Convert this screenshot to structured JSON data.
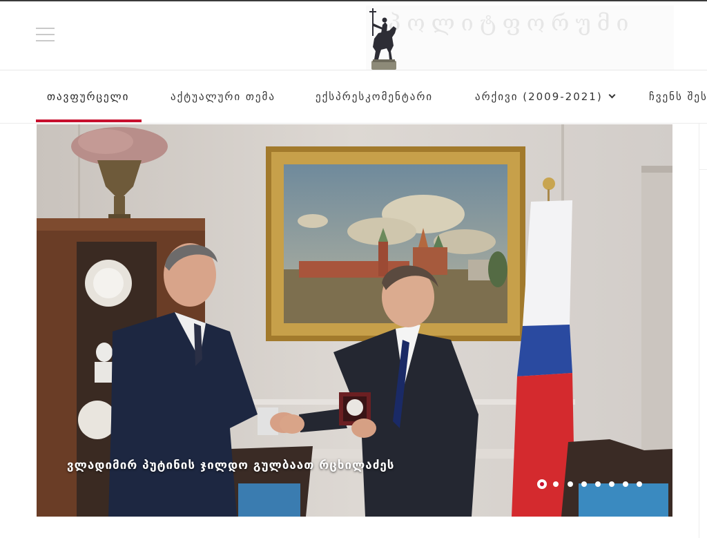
{
  "header": {
    "logo_text": "პოლიტფორუმი",
    "menu_icon": "hamburger-menu-icon"
  },
  "nav": {
    "items": [
      {
        "label": "თავფურცელი",
        "active": true
      },
      {
        "label": "აქტუალური თემა",
        "active": false
      },
      {
        "label": "ექსპრესკომენტარი",
        "active": false
      },
      {
        "label": "არქივი (2009-2021)",
        "active": false,
        "has_dropdown": true
      },
      {
        "label": "ჩვენს შესახებ",
        "active": false
      }
    ],
    "accent_color": "#c8102e"
  },
  "slider": {
    "caption": "ვლადიმირ პუტინის ჯილდო გულბაათ რცხილაძეს",
    "slide_count": 8,
    "active_slide": 1
  }
}
